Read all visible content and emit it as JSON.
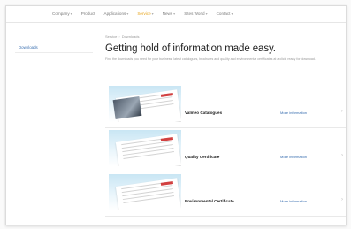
{
  "nav": {
    "items": [
      {
        "label": "Company",
        "chevron": true,
        "active": false
      },
      {
        "label": "Product",
        "chevron": false,
        "active": false
      },
      {
        "label": "Applications",
        "chevron": true,
        "active": false
      },
      {
        "label": "Service",
        "chevron": true,
        "active": true
      },
      {
        "label": "News",
        "chevron": true,
        "active": false
      },
      {
        "label": "Sites World",
        "chevron": true,
        "active": false
      },
      {
        "label": "Contact",
        "chevron": true,
        "active": false
      }
    ]
  },
  "sidebar": {
    "items": [
      {
        "label": "Downloads"
      }
    ]
  },
  "breadcrumb": {
    "parent": "Service",
    "current": "Downloads"
  },
  "main": {
    "title": "Getting hold of information made easy.",
    "intro": "Find the downloads you need for your business: latest catalogues, brochures and quality and environmental certificates at a click, ready for download."
  },
  "cards": [
    {
      "title": "Valmeo Catalogues",
      "link": "More information",
      "thumb": "catalogue-brochure-image"
    },
    {
      "title": "Quality Certificate",
      "link": "More information",
      "thumb": "certificate-document-image"
    },
    {
      "title": "Environmental Certificate",
      "link": "More information",
      "thumb": "certificate-document-image"
    }
  ],
  "colors": {
    "accent": "#e6a51e",
    "link": "#3a6fb0"
  }
}
